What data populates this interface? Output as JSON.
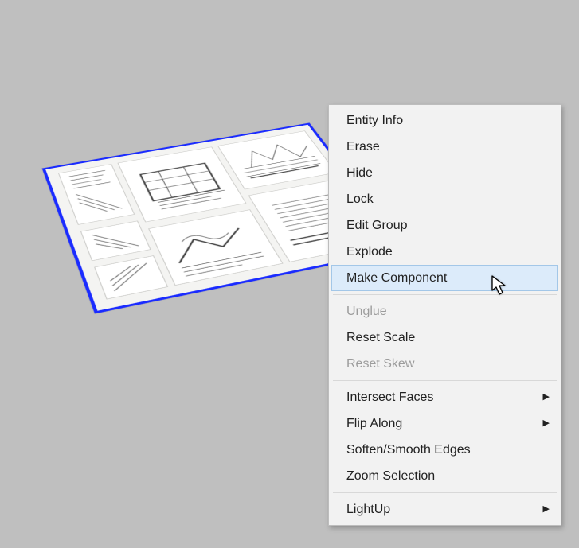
{
  "context_menu": {
    "groups": [
      {
        "items": [
          {
            "id": "entity-info",
            "label": "Entity Info",
            "enabled": true,
            "submenu": false
          },
          {
            "id": "erase",
            "label": "Erase",
            "enabled": true,
            "submenu": false
          },
          {
            "id": "hide",
            "label": "Hide",
            "enabled": true,
            "submenu": false
          },
          {
            "id": "lock",
            "label": "Lock",
            "enabled": true,
            "submenu": false
          },
          {
            "id": "edit-group",
            "label": "Edit Group",
            "enabled": true,
            "submenu": false
          },
          {
            "id": "explode",
            "label": "Explode",
            "enabled": true,
            "submenu": false
          },
          {
            "id": "make-component",
            "label": "Make Component",
            "enabled": true,
            "submenu": false,
            "hover": true
          }
        ]
      },
      {
        "items": [
          {
            "id": "unglue",
            "label": "Unglue",
            "enabled": false,
            "submenu": false
          },
          {
            "id": "reset-scale",
            "label": "Reset Scale",
            "enabled": true,
            "submenu": false
          },
          {
            "id": "reset-skew",
            "label": "Reset Skew",
            "enabled": false,
            "submenu": false
          }
        ]
      },
      {
        "items": [
          {
            "id": "intersect-faces",
            "label": "Intersect Faces",
            "enabled": true,
            "submenu": true
          },
          {
            "id": "flip-along",
            "label": "Flip Along",
            "enabled": true,
            "submenu": true
          },
          {
            "id": "soften-smooth",
            "label": "Soften/Smooth Edges",
            "enabled": true,
            "submenu": false
          },
          {
            "id": "zoom-selection",
            "label": "Zoom Selection",
            "enabled": true,
            "submenu": false
          }
        ]
      },
      {
        "items": [
          {
            "id": "lightup",
            "label": "LightUp",
            "enabled": true,
            "submenu": true
          }
        ]
      }
    ]
  },
  "selection": {
    "type": "group",
    "highlighted": true,
    "description": "selected-drawing-sheet-group"
  }
}
